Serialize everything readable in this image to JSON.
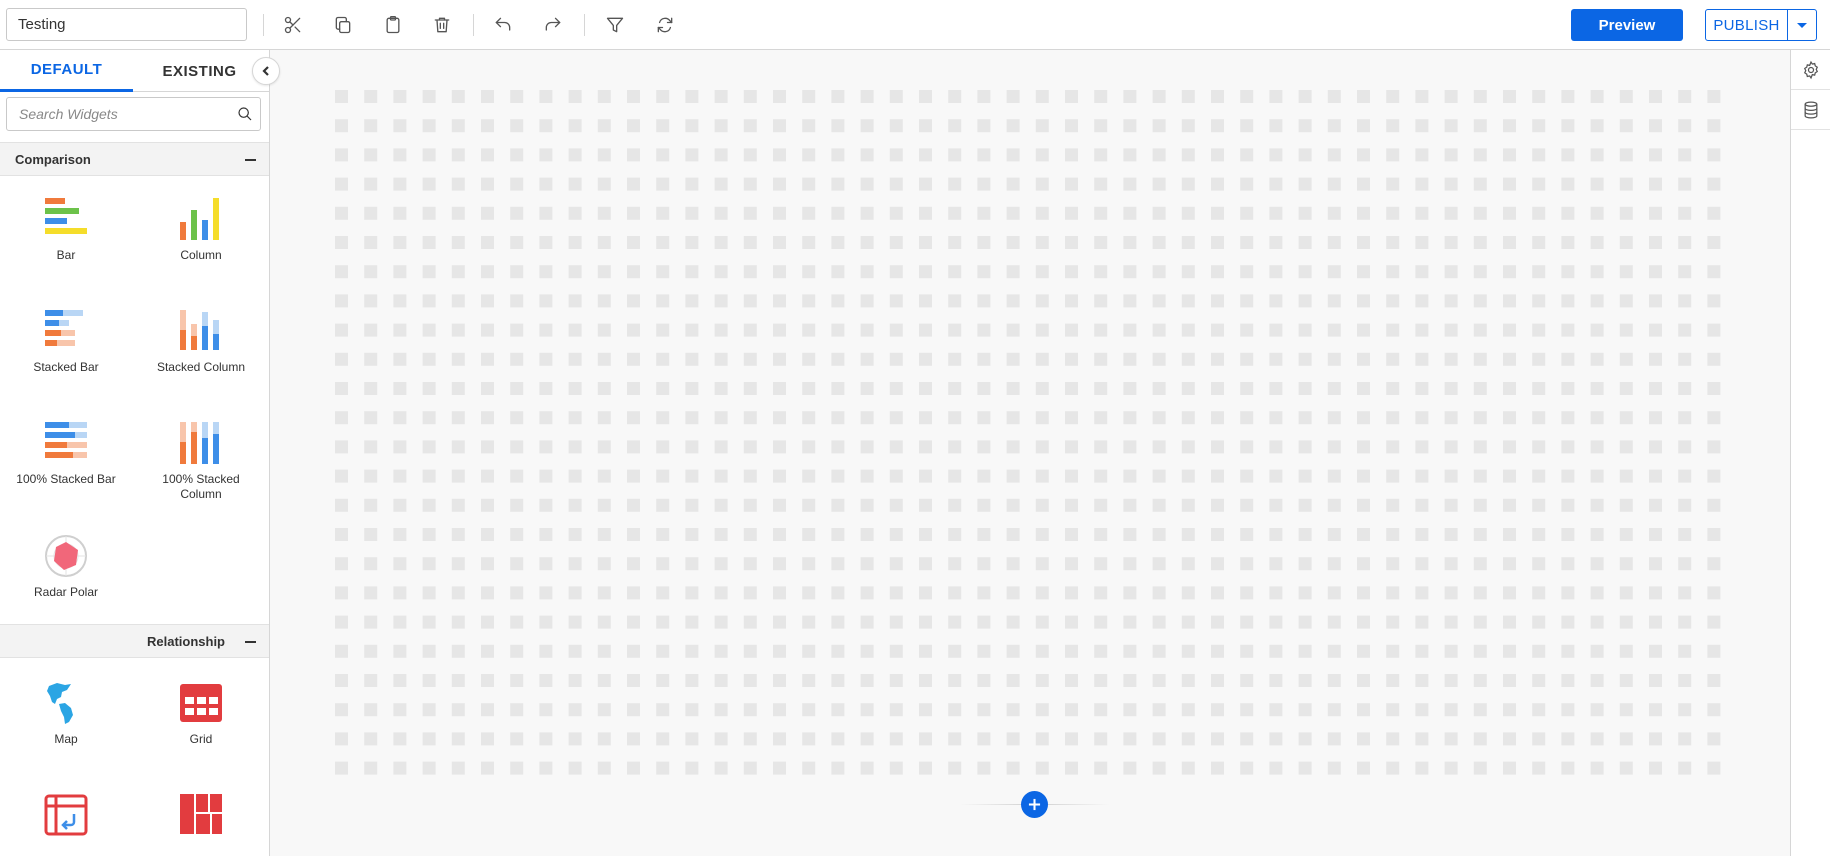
{
  "toolbar": {
    "dashboard_name": "Testing",
    "preview_label": "Preview",
    "publish_label": "PUBLISH",
    "tools": [
      "scissors-icon",
      "copy-icon",
      "paste-icon",
      "trash-icon",
      "undo-icon",
      "redo-icon",
      "filter-icon",
      "refresh-icon"
    ]
  },
  "left_panel": {
    "tabs": [
      {
        "label": "DEFAULT",
        "active": true
      },
      {
        "label": "EXISTING",
        "active": false
      }
    ],
    "search_placeholder": "Search Widgets",
    "categories": [
      {
        "label": "Comparison",
        "widgets": [
          {
            "label": "Bar",
            "icon": "bar-chart-icon"
          },
          {
            "label": "Column",
            "icon": "column-chart-icon"
          },
          {
            "label": "Stacked Bar",
            "icon": "stacked-bar-icon"
          },
          {
            "label": "Stacked Column",
            "icon": "stacked-column-icon"
          },
          {
            "label": "100% Stacked Bar",
            "icon": "full-stacked-bar-icon"
          },
          {
            "label": "100% Stacked Column",
            "icon": "full-stacked-column-icon"
          },
          {
            "label": "Radar Polar",
            "icon": "radar-polar-icon"
          }
        ]
      },
      {
        "label": "Relationship",
        "widgets": [
          {
            "label": "Map",
            "icon": "map-icon"
          },
          {
            "label": "Grid",
            "icon": "grid-icon"
          },
          {
            "label": "",
            "icon": "pivot-grid-icon"
          },
          {
            "label": "",
            "icon": "treemap-icon"
          }
        ]
      }
    ]
  },
  "colors": {
    "accent": "#0b66e4",
    "orange": "#f07a3c",
    "green": "#6cc24a",
    "blue": "#3d8ee8",
    "yellow": "#f5dd2a",
    "peach": "#f8c5ab",
    "light_blue": "#b9d6f5",
    "red": "#e23c3f",
    "pink": "#f1677a",
    "map_blue": "#2ba5e4"
  },
  "right_rail": [
    "settings-gear-icon",
    "datasource-icon"
  ]
}
